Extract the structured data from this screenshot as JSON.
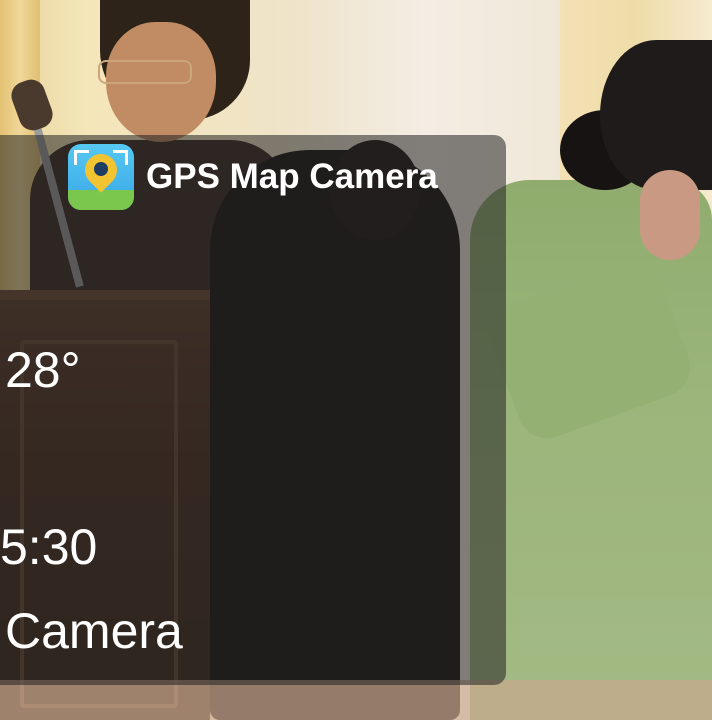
{
  "overlay": {
    "app_title": "GPS Map Camera",
    "temperature": "28°",
    "time_fragment": "5:30",
    "brand_fragment": "Camera",
    "app_icon": "gps-map-camera-logo"
  },
  "colors": {
    "overlay_background": "#232323",
    "text": "#ffffff"
  }
}
